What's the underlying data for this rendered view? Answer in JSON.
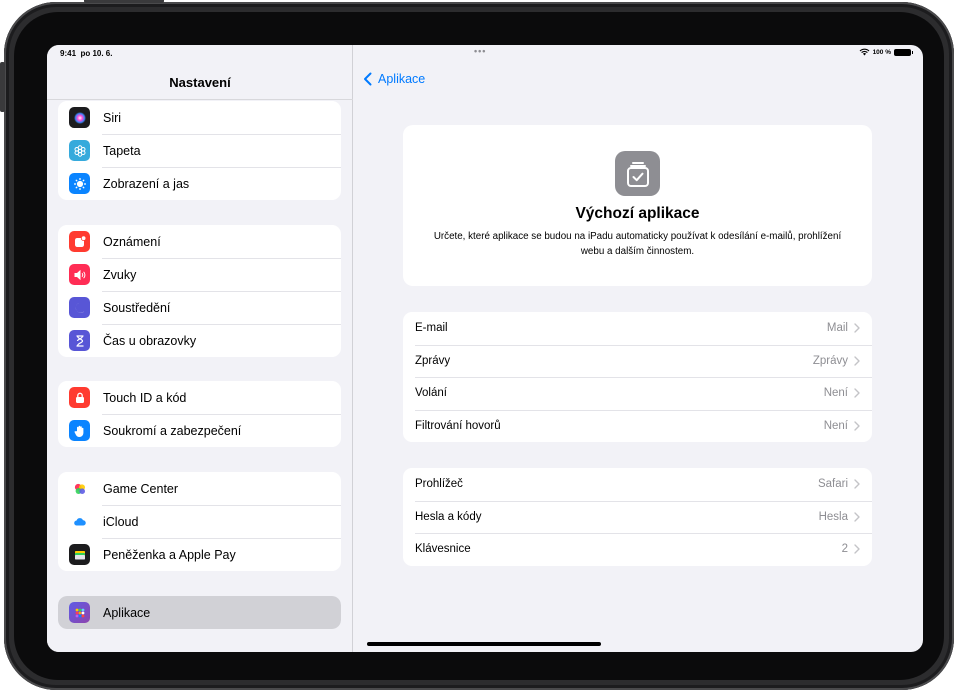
{
  "status": {
    "time": "9:41",
    "date": "po 10. 6.",
    "dots": "•••",
    "battery": "100 %"
  },
  "sidebar": {
    "title": "Nastavení",
    "groups": [
      [
        {
          "label": "Siri",
          "icon": "siri-icon",
          "color": "#1c1c1e"
        },
        {
          "label": "Tapeta",
          "icon": "flower-icon",
          "color": "#36aadc"
        },
        {
          "label": "Zobrazení a jas",
          "icon": "sun-icon",
          "color": "#0a84ff"
        }
      ],
      [
        {
          "label": "Oznámení",
          "icon": "notification-icon",
          "color": "#ff3b30"
        },
        {
          "label": "Zvuky",
          "icon": "speaker-icon",
          "color": "#ff2d55"
        },
        {
          "label": "Soustředění",
          "icon": "moon-icon",
          "color": "#5856d6"
        },
        {
          "label": "Čas u obrazovky",
          "icon": "hourglass-icon",
          "color": "#5856d6"
        }
      ],
      [
        {
          "label": "Touch ID a kód",
          "icon": "lock-icon",
          "color": "#ff3b30"
        },
        {
          "label": "Soukromí a zabezpečení",
          "icon": "hand-icon",
          "color": "#0a84ff"
        }
      ],
      [
        {
          "label": "Game Center",
          "icon": "game-center-icon",
          "color": "#ffffff"
        },
        {
          "label": "iCloud",
          "icon": "cloud-icon",
          "color": "#ffffff"
        },
        {
          "label": "Peněženka a Apple Pay",
          "icon": "wallet-icon",
          "color": "#1c1c1e"
        }
      ],
      [
        {
          "label": "Aplikace",
          "icon": "apps-grid-icon",
          "color": "#5856d6",
          "selected": true
        }
      ]
    ]
  },
  "detail": {
    "back_label": "Aplikace",
    "hero_title": "Výchozí aplikace",
    "hero_desc": "Určete, které aplikace se budou na iPadu automaticky používat k odesílání e-mailů, prohlížení webu a dalším činnostem.",
    "list1": [
      {
        "label": "E-mail",
        "value": "Mail"
      },
      {
        "label": "Zprávy",
        "value": "Zprávy"
      },
      {
        "label": "Volání",
        "value": "Není"
      },
      {
        "label": "Filtrování hovorů",
        "value": "Není"
      }
    ],
    "list2": [
      {
        "label": "Prohlížeč",
        "value": "Safari"
      },
      {
        "label": "Hesla a kódy",
        "value": "Hesla"
      },
      {
        "label": "Klávesnice",
        "value": "2"
      }
    ]
  }
}
